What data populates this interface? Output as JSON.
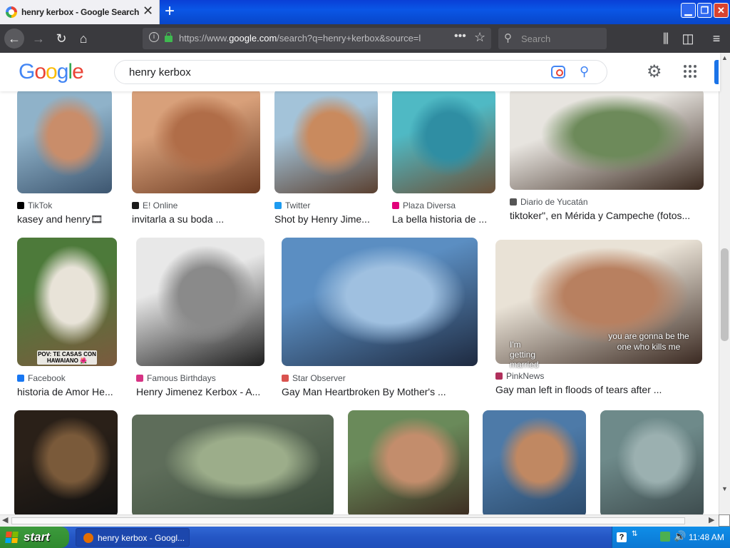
{
  "window": {
    "tab_title": "henry kerbox - Google Search",
    "tab_close": "✕",
    "new_tab": "+",
    "min": "▁",
    "max": "❐",
    "close": "✕"
  },
  "navbar": {
    "url_prefix": "https://www.",
    "url_domain": "google.com",
    "url_rest": "/search?q=henry+kerbox&source=l",
    "search_placeholder": "Search"
  },
  "google": {
    "logo": "Google",
    "query": "henry kerbox"
  },
  "results": [
    {
      "source": "TikTok",
      "caption": "kasey and henry🎞",
      "src_color": "#000000",
      "img_colors": [
        "#8fb2c9",
        "#c98d6a",
        "#3d5670"
      ]
    },
    {
      "source": "E! Online",
      "caption": "invitarla a su boda ...",
      "src_color": "#1a1a1a",
      "img_colors": [
        "#d8a07a",
        "#b06d48",
        "#6c3b22"
      ]
    },
    {
      "source": "Twitter",
      "caption": "Shot by Henry Jime...",
      "src_color": "#1d9bf0",
      "img_colors": [
        "#a3c3d9",
        "#c98a5e",
        "#5a4030"
      ]
    },
    {
      "source": "Plaza Diversa",
      "caption": "La bella historia de ...",
      "src_color": "#e2007a",
      "img_colors": [
        "#4fb9c4",
        "#2f8ea3",
        "#6b5038"
      ]
    },
    {
      "source": "Diario de Yucatán",
      "caption": "tiktoker\", en Mérida y Campeche (fotos...",
      "src_color": "#555555",
      "img_colors": [
        "#e7e4df",
        "#6d8a5a",
        "#3b2a20"
      ]
    },
    {
      "source": "Facebook",
      "caption": "historia de Amor He...",
      "src_color": "#1877f2",
      "img_colors": [
        "#4d7a3a",
        "#e8e3d8",
        "#7b5a3e"
      ],
      "overlay": "POV: TE CASAS CON HAWAIANO 🌺"
    },
    {
      "source": "Famous Birthdays",
      "caption": "Henry Jimenez Kerbox - A...",
      "src_color": "#d63384",
      "img_colors": [
        "#e8e8e8",
        "#8a8a8a",
        "#1e1e1e"
      ]
    },
    {
      "source": "Star Observer",
      "caption": "Gay Man Heartbroken By Mother's ...",
      "src_color": "#d9534f",
      "img_colors": [
        "#5b8ec2",
        "#9fc0e0",
        "#1e2a40"
      ]
    },
    {
      "source": "PinkNews",
      "caption": "Gay man left in floods of tears after ...",
      "src_color": "#b0305c",
      "img_colors": [
        "#e9e2d6",
        "#b88060",
        "#3b2a22"
      ],
      "overlay": "I'm getting married",
      "overlay2": "you are gonna be the one who kills me"
    },
    {
      "img_colors": [
        "#2a2018",
        "#7a5a3a",
        "#111111"
      ]
    },
    {
      "img_colors": [
        "#5e6d5a",
        "#9cad8a",
        "#3a4a3a"
      ]
    },
    {
      "img_colors": [
        "#6a8a5a",
        "#c38d6c",
        "#3b2b20"
      ]
    },
    {
      "img_colors": [
        "#4d7aa8",
        "#c08862",
        "#2b4a6b"
      ]
    },
    {
      "img_colors": [
        "#6e8a8a",
        "#9bb0b0",
        "#3d4b4d"
      ]
    }
  ],
  "taskbar": {
    "start": "start",
    "task_title": "henry kerbox - Googl...",
    "help": "?",
    "time": "11:48 AM"
  }
}
